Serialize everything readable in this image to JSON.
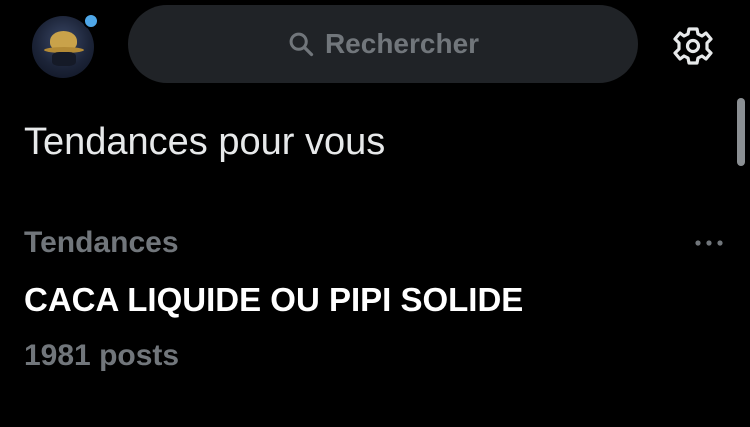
{
  "search": {
    "placeholder": "Rechercher"
  },
  "explore": {
    "section_title": "Tendances pour vous",
    "trends": [
      {
        "category": "Tendances",
        "name": "CACA LIQUIDE OU PIPI SOLIDE",
        "post_count": "1981 posts"
      }
    ]
  },
  "icons": {
    "search": "search-icon",
    "settings": "gear-icon",
    "more": "more-dots-icon"
  },
  "colors": {
    "background": "#000000",
    "search_bg": "#202327",
    "muted_text": "#71767b",
    "primary_text": "#e7e9ea",
    "notification_dot": "#4fa7e8"
  }
}
